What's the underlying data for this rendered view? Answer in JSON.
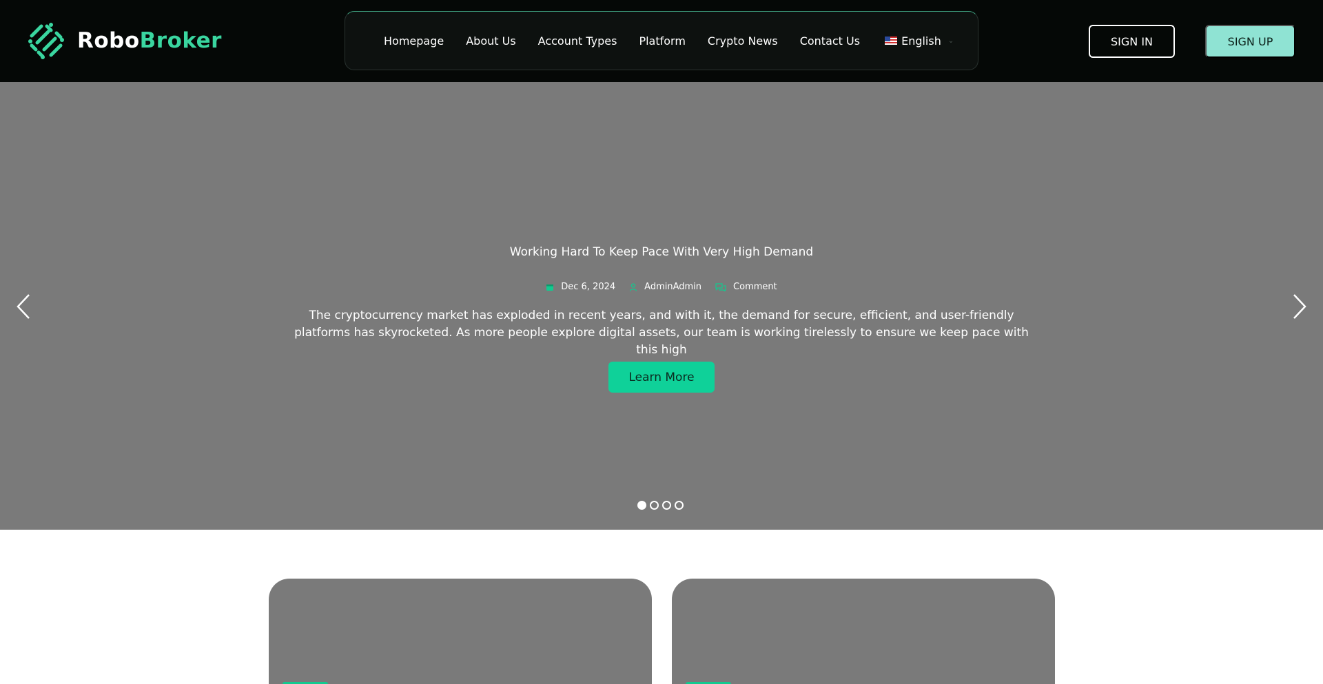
{
  "brand": {
    "part1": "Robo",
    "part2": "Broker",
    "logo_icon": "robobroker-logo-icon",
    "accent": "#3ad6a0"
  },
  "nav": {
    "items": [
      {
        "label": "Homepage"
      },
      {
        "label": "About Us"
      },
      {
        "label": "Account Types"
      },
      {
        "label": "Platform"
      },
      {
        "label": "Crypto News"
      },
      {
        "label": "Contact Us"
      }
    ],
    "language": {
      "label": "English",
      "flag_icon": "us-flag-icon"
    }
  },
  "auth": {
    "signin_label": "SIGN IN",
    "signup_label": "SIGN UP"
  },
  "hero": {
    "title": "Working Hard To Keep Pace With Very High Demand",
    "meta": {
      "date": "Dec 6, 2024",
      "author": "AdminAdmin",
      "comment": "Comment"
    },
    "excerpt": "The cryptocurrency market has exploded in recent years, and with it, the demand for secure, efficient, and user-friendly platforms has skyrocketed. As more people explore digital assets, our team is working tirelessly to ensure we keep pace with this high",
    "button_label": "Learn More",
    "active_slide": 1,
    "slide_count": 4,
    "button_color": "#0fd199",
    "background": "#7a7a7a"
  }
}
